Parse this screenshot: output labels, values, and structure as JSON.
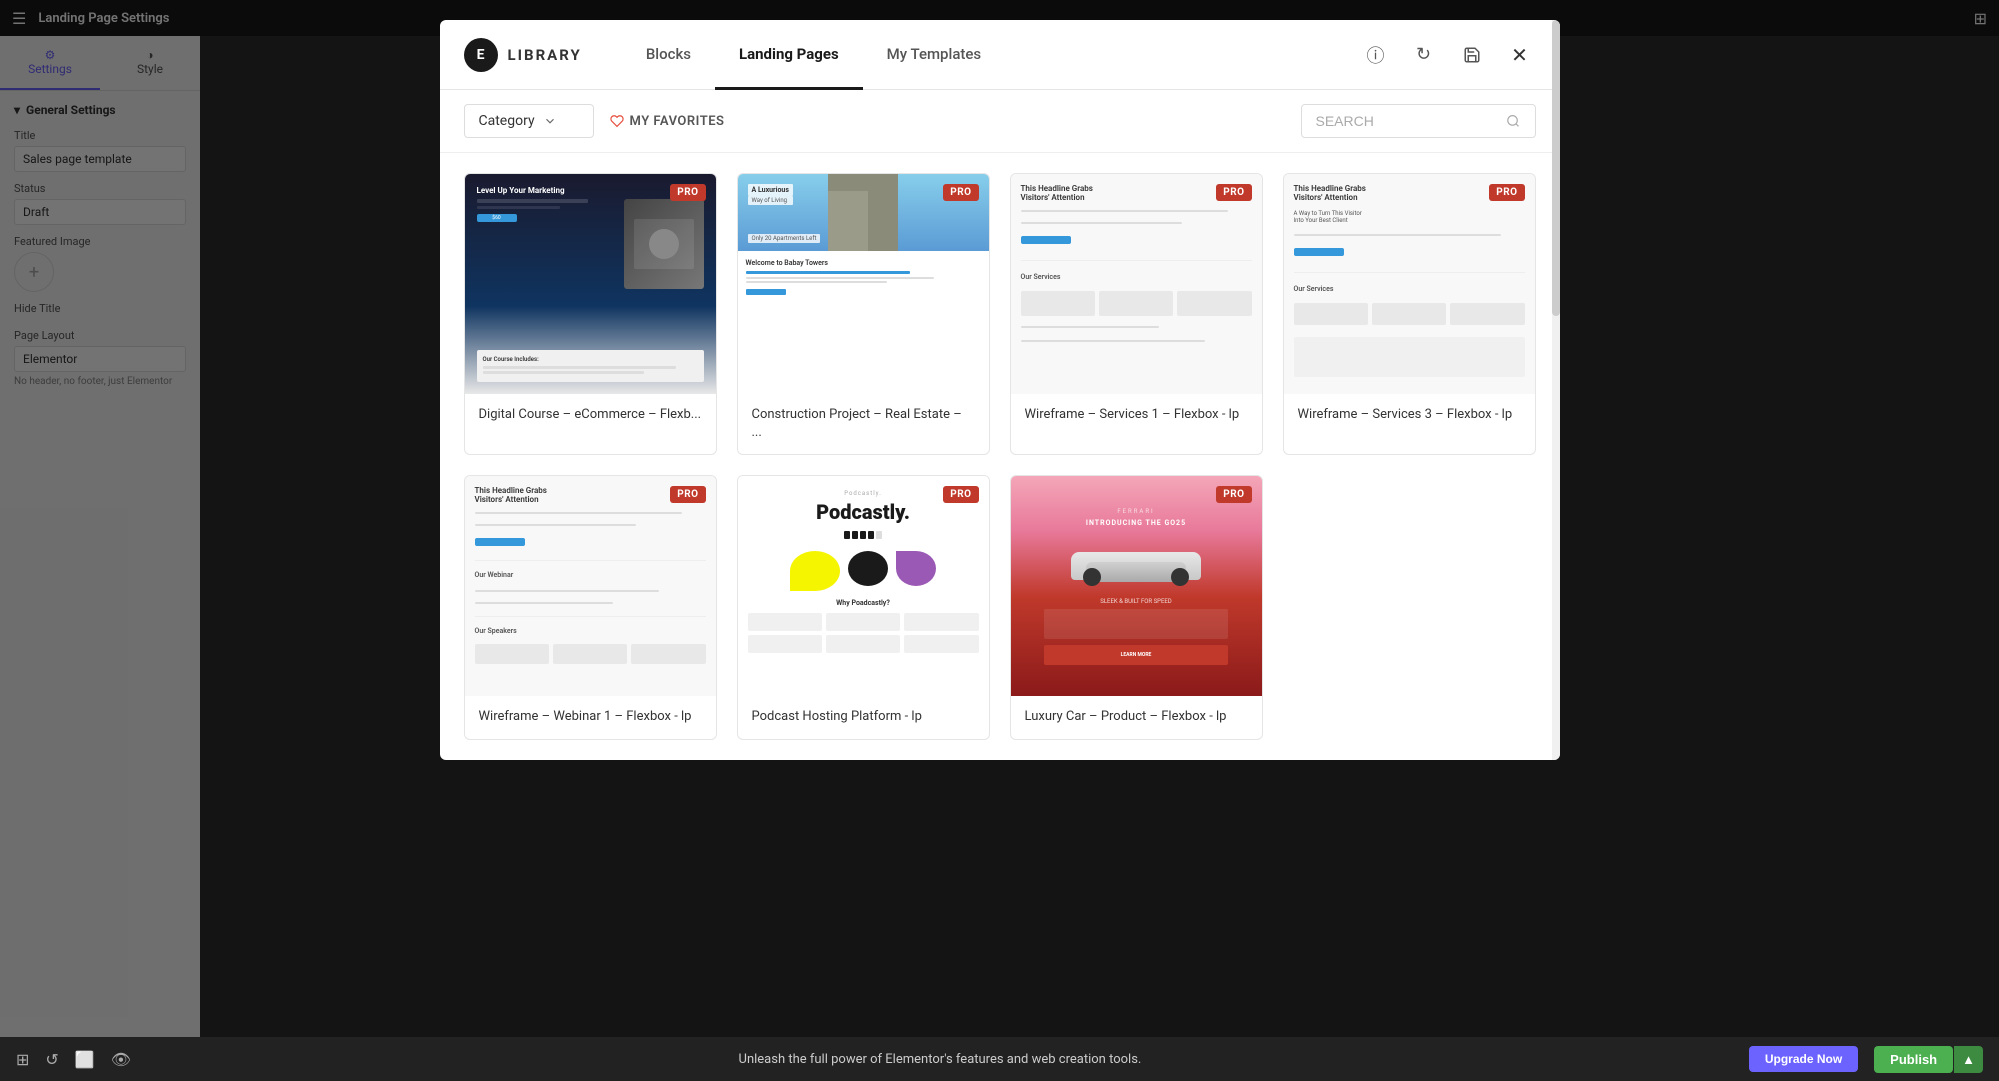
{
  "app": {
    "title": "Landing Page Settings"
  },
  "topbar": {
    "title": "Landing Page Settings",
    "grid_icon": "grid-icon"
  },
  "sidebar": {
    "tabs": [
      {
        "label": "Settings",
        "active": true
      },
      {
        "label": "Style",
        "active": false
      }
    ],
    "sections": [
      {
        "label": "General Settings",
        "fields": [
          {
            "label": "Title",
            "value": "Sales page template"
          },
          {
            "label": "Status",
            "value": "Draft"
          },
          {
            "label": "Featured Image",
            "value": ""
          },
          {
            "label": "Hide Title",
            "value": ""
          },
          {
            "label": "Page Layout",
            "value": "Elementor"
          },
          {
            "label": "layout_note",
            "value": "No header, no footer, just Elementor"
          }
        ]
      }
    ]
  },
  "modal": {
    "logo_letter": "E",
    "logo_text": "LIBRARY",
    "tabs": [
      {
        "label": "Blocks",
        "active": false
      },
      {
        "label": "Landing Pages",
        "active": true
      },
      {
        "label": "My Templates",
        "active": false
      }
    ],
    "header_icons": [
      {
        "name": "info-icon",
        "symbol": "ⓘ"
      },
      {
        "name": "refresh-icon",
        "symbol": "↻"
      },
      {
        "name": "save-icon",
        "symbol": "⊡"
      },
      {
        "name": "close-icon",
        "symbol": "✕"
      }
    ],
    "filter": {
      "category_label": "Category",
      "favorites_label": "MY FAVORITES",
      "search_placeholder": "SEARCH"
    },
    "templates": [
      {
        "id": 1,
        "label": "Digital Course – eCommerce – Flexb...",
        "pro": true,
        "theme": "dark-course"
      },
      {
        "id": 2,
        "label": "Construction Project – Real Estate – ...",
        "pro": true,
        "theme": "construction"
      },
      {
        "id": 3,
        "label": "Wireframe – Services 1 – Flexbox - lp",
        "pro": true,
        "theme": "wireframe-1"
      },
      {
        "id": 4,
        "label": "Wireframe – Services 3 – Flexbox - lp",
        "pro": true,
        "theme": "wireframe-3"
      },
      {
        "id": 5,
        "label": "Wireframe – Webinar 1 – Flexbox - lp",
        "pro": true,
        "theme": "wireframe-webinar"
      },
      {
        "id": 6,
        "label": "Podcast Hosting Platform - lp",
        "pro": true,
        "theme": "podcast"
      },
      {
        "id": 7,
        "label": "Luxury Car – Product – Flexbox - lp",
        "pro": true,
        "theme": "luxury-car"
      }
    ]
  },
  "bottom_bar": {
    "promo_text": "Unleash the full power of Elementor's features and web creation tools.",
    "upgrade_label": "Upgrade Now",
    "publish_label": "Publish",
    "icons": [
      "layers-icon",
      "history-icon",
      "responsive-icon",
      "eye-icon"
    ]
  }
}
